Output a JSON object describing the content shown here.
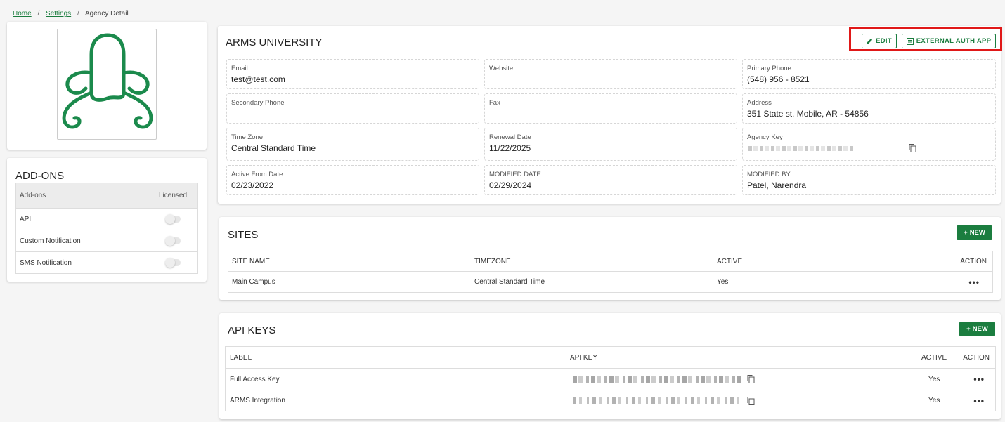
{
  "breadcrumb": {
    "home": "Home",
    "settings": "Settings",
    "current": "Agency Detail",
    "separator": "/"
  },
  "colors": {
    "accent": "#1b7d3f",
    "highlight": "#e01818"
  },
  "addons": {
    "title": "ADD-ONS",
    "col_name": "Add-ons",
    "col_licensed": "Licensed",
    "items": [
      {
        "name": "API",
        "licensed": false
      },
      {
        "name": "Custom Notification",
        "licensed": false
      },
      {
        "name": "SMS Notification",
        "licensed": false
      }
    ]
  },
  "agency": {
    "name": "ARMS UNIVERSITY",
    "edit_label": "EDIT",
    "external_auth_label": "EXTERNAL AUTH APP",
    "fields": {
      "email": {
        "label": "Email",
        "value": "test@test.com"
      },
      "website": {
        "label": "Website",
        "value": ""
      },
      "primary_phone": {
        "label": "Primary Phone",
        "value": "(548) 956 - 8521"
      },
      "secondary_phone": {
        "label": "Secondary Phone",
        "value": ""
      },
      "fax": {
        "label": "Fax",
        "value": ""
      },
      "address": {
        "label": "Address",
        "value": "351 State st, Mobile, AR - 54856"
      },
      "time_zone": {
        "label": "Time Zone",
        "value": "Central Standard Time"
      },
      "renewal_date": {
        "label": "Renewal Date",
        "value": "11/22/2025"
      },
      "agency_key": {
        "label": "Agency Key",
        "value": ""
      },
      "active_from": {
        "label": "Active From Date",
        "value": "02/23/2022"
      },
      "modified_date": {
        "label": "MODIFIED DATE",
        "value": "02/29/2024"
      },
      "modified_by": {
        "label": "MODIFIED BY",
        "value": "Patel, Narendra"
      }
    }
  },
  "sites": {
    "title": "SITES",
    "new_label": "NEW",
    "columns": {
      "name": "SITE NAME",
      "timezone": "TIMEZONE",
      "active": "ACTIVE",
      "action": "ACTION"
    },
    "rows": [
      {
        "name": "Main Campus",
        "timezone": "Central Standard Time",
        "active": "Yes",
        "action": "•••"
      }
    ]
  },
  "api_keys": {
    "title": "API KEYS",
    "new_label": "NEW",
    "columns": {
      "label": "LABEL",
      "key": "API KEY",
      "active": "ACTIVE",
      "action": "ACTION"
    },
    "rows": [
      {
        "label": "Full Access Key",
        "active": "Yes",
        "action": "•••"
      },
      {
        "label": "ARMS Integration",
        "active": "Yes",
        "action": "•••"
      }
    ]
  }
}
